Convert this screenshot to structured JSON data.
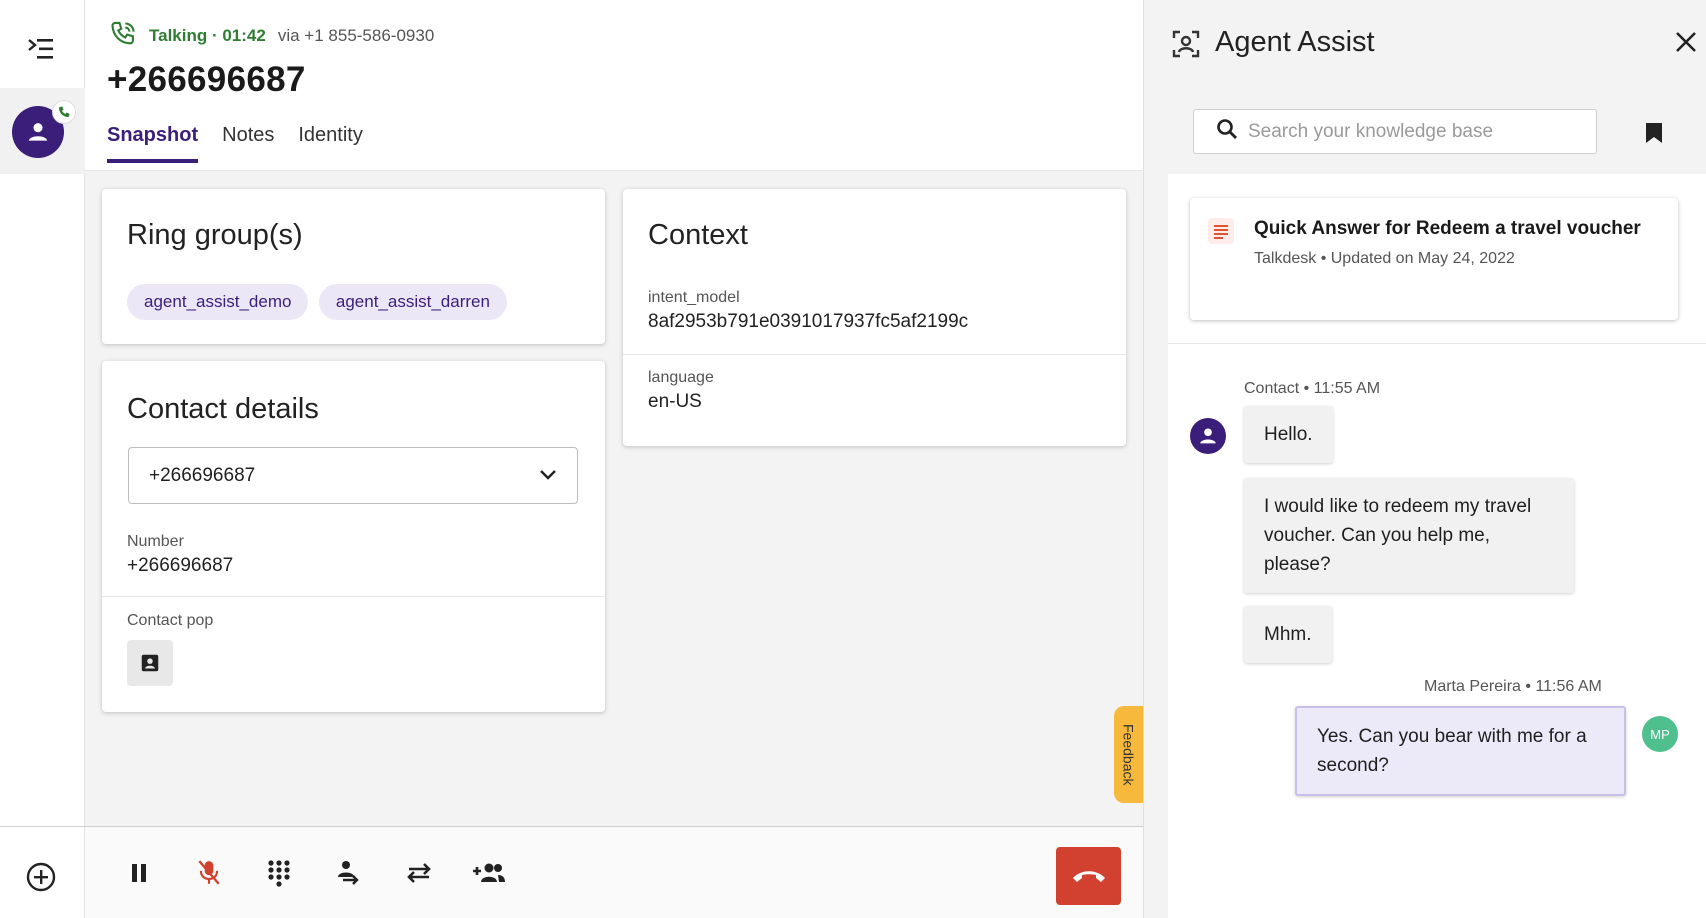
{
  "call": {
    "status": "Talking · 01:42",
    "via": "via +1 855-586-0930",
    "number": "+266696687"
  },
  "tabs": [
    {
      "label": "Snapshot",
      "active": true
    },
    {
      "label": "Notes",
      "active": false
    },
    {
      "label": "Identity",
      "active": false
    }
  ],
  "ring_groups": {
    "title": "Ring group(s)",
    "chips": [
      "agent_assist_demo",
      "agent_assist_darren"
    ]
  },
  "contact_details": {
    "title": "Contact details",
    "selected_number": "+266696687",
    "number_label": "Number",
    "number_value": "+266696687",
    "contact_pop_label": "Contact pop"
  },
  "context": {
    "title": "Context",
    "fields": [
      {
        "label": "intent_model",
        "value": "8af2953b791e0391017937fc5af2199c"
      },
      {
        "label": "language",
        "value": "en-US"
      }
    ]
  },
  "feedback_label": "Feedback",
  "call_controls": [
    "pause-icon",
    "mute-icon",
    "dialpad-icon",
    "consult-icon",
    "transfer-icon",
    "add-participant-icon",
    "hangup-icon"
  ],
  "agent_assist": {
    "title": "Agent Assist",
    "search_placeholder": "Search your knowledge base",
    "quick_answer": {
      "title": "Quick Answer for Redeem a travel voucher",
      "meta": "Talkdesk • Updated on May 24, 2022"
    },
    "transcript": {
      "contact_meta": "Contact • 11:55 AM",
      "contact_messages": [
        "Hello.",
        "I would like to redeem my travel voucher. Can you help me, please?",
        "Mhm."
      ],
      "agent_meta": "Marta Pereira • 11:56 AM",
      "agent_message": "Yes. Can you bear with me for a second?",
      "agent_initials": "MP"
    }
  },
  "colors": {
    "brand_purple": "#3a1e7a",
    "talking_green": "#2e7d32",
    "hangup_red": "#d2402f",
    "feedback_orange": "#f6b93b",
    "muted_red": "#d2402f"
  }
}
